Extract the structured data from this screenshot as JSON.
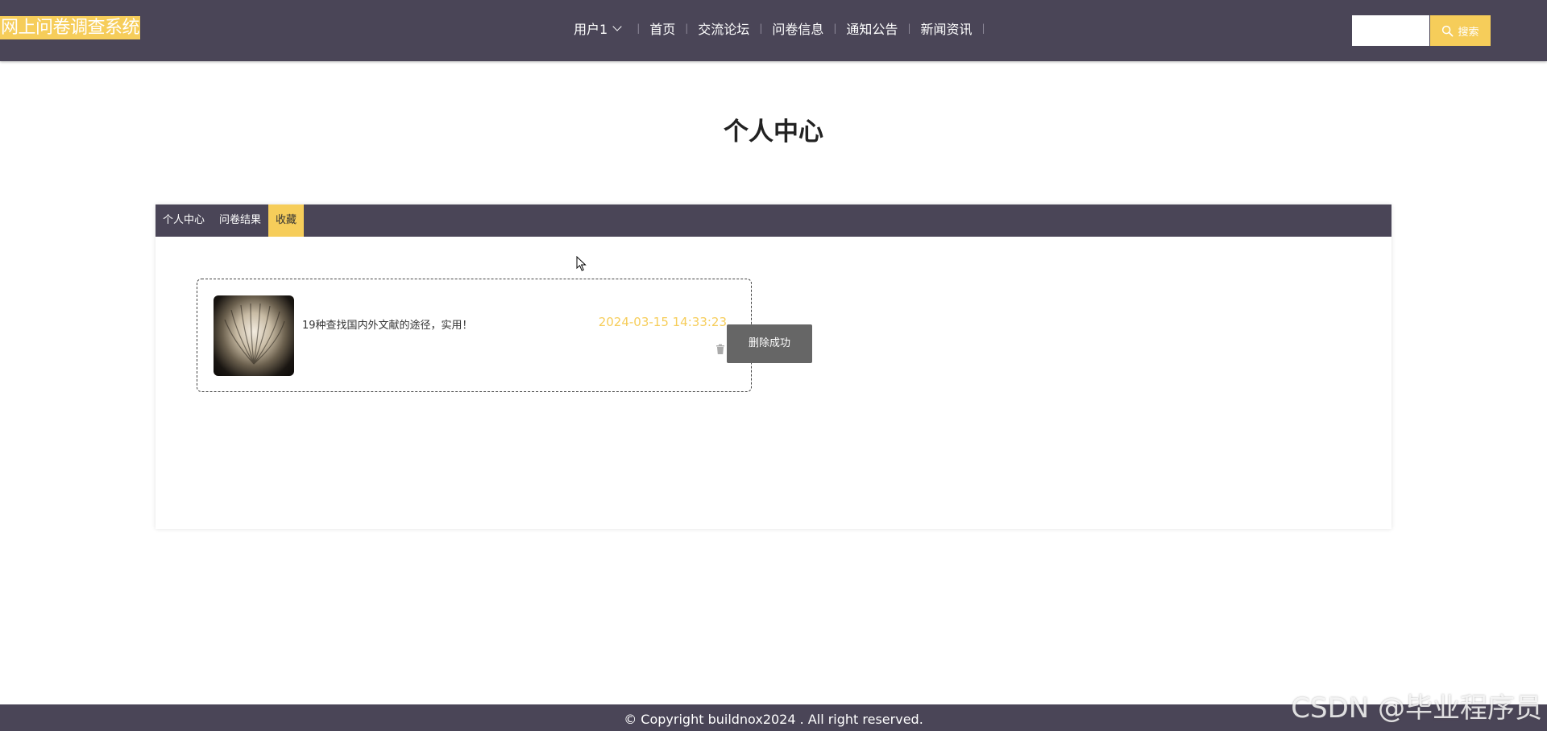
{
  "header": {
    "logo": "网上问卷调查系统",
    "user_menu": "用户1",
    "nav": [
      "首页",
      "交流论坛",
      "问卷信息",
      "通知公告",
      "新闻资讯"
    ],
    "search": {
      "value": "",
      "placeholder": "",
      "button_label": "搜索"
    }
  },
  "page": {
    "title": "个人中心"
  },
  "tabs": [
    {
      "label": "个人中心",
      "active": false
    },
    {
      "label": "问卷结果",
      "active": false
    },
    {
      "label": "收藏",
      "active": true
    }
  ],
  "favorites": [
    {
      "title": "19种查找国内外文献的途径，实用！",
      "time": "2024-03-15 14:33:23",
      "icon": "trash-icon"
    }
  ],
  "toast": {
    "message": "删除成功"
  },
  "footer": {
    "copyright": "© Copyright buildnox2024 . All right reserved."
  },
  "watermark": "CSDN @毕业程序员",
  "colors": {
    "header_bg": "#4a4557",
    "accent": "#f6cd5a",
    "toast_bg": "#666666"
  }
}
